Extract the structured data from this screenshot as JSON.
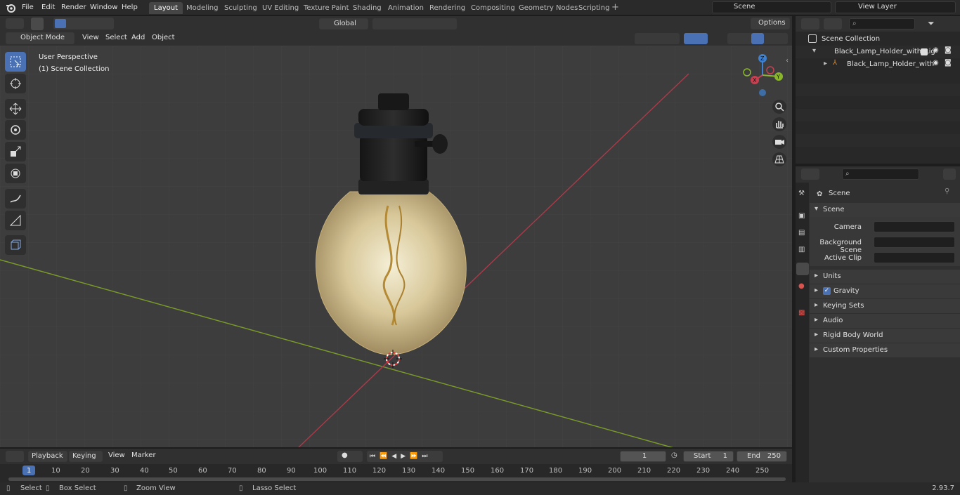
{
  "topbar": {
    "menus": [
      "File",
      "Edit",
      "Render",
      "Window",
      "Help"
    ],
    "workspaces": [
      "Layout",
      "Modeling",
      "Sculpting",
      "UV Editing",
      "Texture Paint",
      "Shading",
      "Animation",
      "Rendering",
      "Compositing",
      "Geometry Nodes",
      "Scripting"
    ],
    "active_workspace": "Layout",
    "scene": "Scene",
    "view_layer": "View Layer"
  },
  "header": {
    "transform_orientation": "Global",
    "options": "Options"
  },
  "viewport_bar": {
    "mode": "Object Mode",
    "menus": [
      "View",
      "Select",
      "Add",
      "Object"
    ]
  },
  "viewport": {
    "perspective": "User Perspective",
    "collection": "(1) Scene Collection",
    "gizmo_axes": [
      "X",
      "Y",
      "Z"
    ]
  },
  "outliner": {
    "root": "Scene Collection",
    "items": [
      {
        "label": "Black_Lamp_Holder_with_Lig"
      },
      {
        "label": "Black_Lamp_Holder_with"
      }
    ]
  },
  "properties": {
    "context": "Scene",
    "section": "Scene",
    "fields": [
      {
        "label": "Camera"
      },
      {
        "label": "Background Scene"
      },
      {
        "label": "Active Clip"
      }
    ],
    "panels": [
      "Units",
      "Gravity",
      "Keying Sets",
      "Audio",
      "Rigid Body World",
      "Custom Properties"
    ]
  },
  "timeline": {
    "menus": [
      "Playback",
      "Keying",
      "View",
      "Marker"
    ],
    "current_frame": "1",
    "start_label": "Start",
    "start": "1",
    "end_label": "End",
    "end": "250",
    "ticks": [
      "1",
      "10",
      "20",
      "30",
      "40",
      "50",
      "60",
      "70",
      "80",
      "90",
      "100",
      "110",
      "120",
      "130",
      "140",
      "150",
      "160",
      "170",
      "180",
      "190",
      "200",
      "210",
      "220",
      "230",
      "240",
      "250"
    ]
  },
  "status": {
    "select": "Select",
    "box_select": "Box Select",
    "zoom_view": "Zoom View",
    "lasso_select": "Lasso Select",
    "version": "2.93.7"
  },
  "colors": {
    "accent": "#4a71b4",
    "x_axis": "#c8404f",
    "y_axis": "#8ab62c",
    "z_axis": "#3f81d1"
  }
}
